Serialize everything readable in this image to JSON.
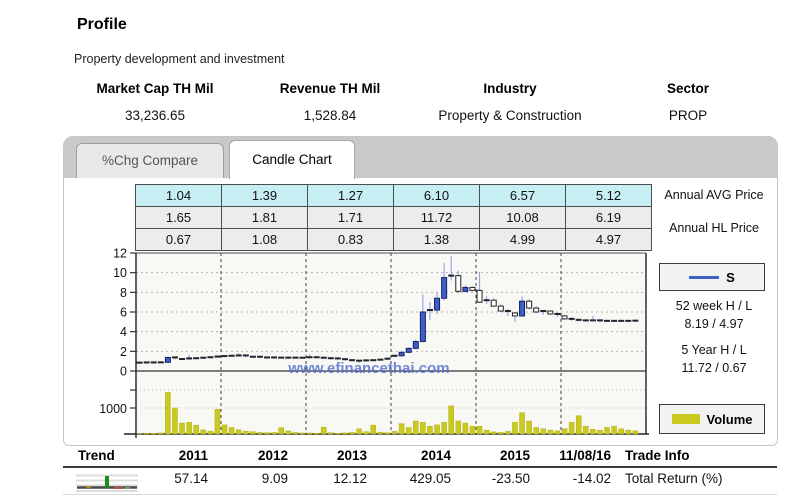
{
  "page": {
    "title": "Profile",
    "subtitle": "Property development and investment"
  },
  "stats": {
    "columns": [
      {
        "label": "Market Cap TH Mil",
        "value": "33,236.65"
      },
      {
        "label": "Revenue TH Mil",
        "value": "1,528.84"
      },
      {
        "label": "Industry",
        "value": "Property & Construction"
      },
      {
        "label": "Sector",
        "value": "PROP"
      }
    ]
  },
  "tabs": [
    {
      "label": "%Chg Compare",
      "active": false
    },
    {
      "label": "Candle Chart",
      "active": true
    }
  ],
  "annual_table": {
    "years": [
      "2011",
      "2012",
      "2013",
      "2014",
      "2015",
      "2016"
    ],
    "avg_row": [
      "1.04",
      "1.39",
      "1.27",
      "6.10",
      "6.57",
      "5.12"
    ],
    "high_row": [
      "1.65",
      "1.81",
      "1.71",
      "11.72",
      "10.08",
      "6.19"
    ],
    "low_row": [
      "0.67",
      "1.08",
      "0.83",
      "1.38",
      "4.99",
      "4.97"
    ]
  },
  "side_panel": {
    "avg_label": "Annual AVG Price",
    "hl_label": "Annual HL Price",
    "series_legend": "S",
    "week52_label": "52 week H / L",
    "week52_value": "8.19 / 4.97",
    "year5_label": "5 Year H / L",
    "year5_value": "11.72 / 0.67",
    "volume_legend": "Volume"
  },
  "watermark": "www.efinancethai.com",
  "chart_data": {
    "type": "candlestick+volume",
    "title": "Candle Chart (monthly, 2011 - 11/08/16)",
    "years": [
      "2011",
      "2012",
      "2013",
      "2014",
      "2015",
      "2016"
    ],
    "price_axis_ticks": [
      0,
      2,
      4,
      6,
      8,
      10,
      12
    ],
    "price_ylim": [
      0,
      12
    ],
    "volume_axis_tick": 1000,
    "grid": true,
    "ohlc_order": "open,high,low,close (monthly from Jan 2011 to Nov 2016)",
    "ohlc": [
      [
        0.85,
        0.9,
        0.8,
        0.85
      ],
      [
        0.85,
        0.92,
        0.78,
        0.87
      ],
      [
        0.87,
        0.9,
        0.82,
        0.85
      ],
      [
        0.85,
        0.92,
        0.8,
        0.88
      ],
      [
        0.88,
        1.45,
        0.85,
        1.38
      ],
      [
        1.38,
        1.45,
        1.18,
        1.22
      ],
      [
        1.22,
        1.3,
        1.12,
        1.18
      ],
      [
        1.18,
        1.65,
        1.1,
        1.28
      ],
      [
        1.28,
        1.35,
        1.2,
        1.3
      ],
      [
        1.3,
        1.38,
        1.25,
        1.35
      ],
      [
        1.35,
        1.42,
        1.28,
        1.4
      ],
      [
        1.4,
        1.5,
        1.35,
        1.47
      ],
      [
        1.47,
        1.55,
        1.42,
        1.52
      ],
      [
        1.52,
        1.6,
        1.45,
        1.55
      ],
      [
        1.55,
        1.81,
        1.48,
        1.58
      ],
      [
        1.58,
        1.62,
        1.38,
        1.42
      ],
      [
        1.42,
        1.5,
        1.35,
        1.45
      ],
      [
        1.45,
        1.48,
        1.3,
        1.35
      ],
      [
        1.35,
        1.42,
        1.28,
        1.38
      ],
      [
        1.38,
        1.42,
        1.3,
        1.36
      ],
      [
        1.36,
        1.4,
        1.28,
        1.34
      ],
      [
        1.34,
        1.4,
        1.25,
        1.36
      ],
      [
        1.36,
        1.4,
        1.3,
        1.35
      ],
      [
        1.35,
        1.4,
        1.28,
        1.33
      ],
      [
        1.33,
        1.71,
        1.25,
        1.4
      ],
      [
        1.4,
        1.45,
        1.3,
        1.35
      ],
      [
        1.35,
        1.38,
        1.25,
        1.3
      ],
      [
        1.3,
        1.35,
        1.2,
        1.28
      ],
      [
        1.28,
        1.32,
        1.15,
        1.2
      ],
      [
        1.2,
        1.25,
        1.05,
        1.1
      ],
      [
        1.1,
        1.18,
        0.95,
        1.05
      ],
      [
        1.05,
        1.1,
        0.83,
        1.0
      ],
      [
        1.0,
        1.12,
        0.95,
        1.08
      ],
      [
        1.08,
        1.15,
        1.0,
        1.1
      ],
      [
        1.1,
        1.2,
        1.05,
        1.15
      ],
      [
        1.15,
        1.3,
        1.1,
        1.25
      ],
      [
        1.38,
        1.6,
        1.38,
        1.55
      ],
      [
        1.55,
        2.0,
        1.45,
        1.9
      ],
      [
        1.9,
        2.4,
        1.8,
        2.3
      ],
      [
        2.3,
        3.2,
        2.2,
        3.0
      ],
      [
        3.0,
        7.8,
        2.9,
        6.0
      ],
      [
        6.0,
        7.0,
        5.2,
        6.2
      ],
      [
        6.2,
        8.0,
        5.8,
        7.4
      ],
      [
        7.4,
        11.0,
        7.2,
        9.5
      ],
      [
        9.5,
        11.72,
        9.2,
        9.7
      ],
      [
        9.7,
        10.2,
        7.9,
        8.1
      ],
      [
        8.1,
        8.7,
        8.0,
        8.5
      ],
      [
        8.5,
        8.6,
        8.1,
        8.2
      ],
      [
        8.2,
        10.08,
        6.9,
        7.0
      ],
      [
        7.0,
        7.6,
        6.8,
        7.2
      ],
      [
        7.2,
        7.4,
        6.5,
        6.6
      ],
      [
        6.6,
        6.8,
        6.0,
        6.1
      ],
      [
        6.1,
        6.3,
        5.6,
        5.9
      ],
      [
        5.9,
        6.0,
        4.99,
        5.6
      ],
      [
        5.6,
        7.6,
        5.5,
        7.1
      ],
      [
        7.1,
        7.3,
        6.3,
        6.4
      ],
      [
        6.4,
        6.6,
        5.9,
        6.0
      ],
      [
        6.0,
        6.2,
        5.7,
        6.1
      ],
      [
        6.1,
        6.15,
        5.7,
        5.8
      ],
      [
        5.8,
        5.95,
        5.5,
        5.6
      ],
      [
        5.6,
        5.7,
        5.2,
        5.3
      ],
      [
        5.3,
        5.45,
        5.1,
        5.2
      ],
      [
        5.2,
        5.3,
        5.05,
        5.15
      ],
      [
        5.15,
        5.25,
        5.0,
        5.1
      ],
      [
        5.1,
        5.6,
        5.05,
        5.15
      ],
      [
        5.15,
        5.25,
        4.97,
        5.1
      ],
      [
        5.1,
        5.15,
        5.0,
        5.05
      ],
      [
        5.05,
        5.15,
        5.0,
        5.1
      ],
      [
        5.1,
        5.2,
        5.0,
        5.05
      ],
      [
        5.05,
        5.15,
        4.98,
        5.1
      ],
      [
        5.1,
        5.15,
        5.05,
        5.12
      ]
    ],
    "volumes": [
      15,
      20,
      25,
      40,
      1600,
      1000,
      420,
      450,
      340,
      160,
      110,
      950,
      350,
      250,
      160,
      110,
      90,
      60,
      50,
      60,
      240,
      120,
      60,
      40,
      40,
      30,
      260,
      50,
      30,
      40,
      60,
      200,
      90,
      340,
      70,
      50,
      100,
      400,
      250,
      500,
      450,
      300,
      350,
      450,
      1080,
      500,
      420,
      300,
      300,
      150,
      80,
      60,
      100,
      450,
      820,
      500,
      250,
      200,
      150,
      120,
      200,
      450,
      700,
      300,
      180,
      150,
      250,
      300,
      200,
      150,
      120
    ]
  },
  "bottom_table": {
    "trend_header": "Trend",
    "trade_info_header": "Trade Info",
    "row_label": "Total Return (%)",
    "columns": [
      {
        "label": "2011",
        "value": "57.14"
      },
      {
        "label": "2012",
        "value": "9.09"
      },
      {
        "label": "2013",
        "value": "12.12"
      },
      {
        "label": "2014",
        "value": "429.05"
      },
      {
        "label": "2015",
        "value": "-23.50"
      },
      {
        "label": "11/08/16",
        "value": "-14.02"
      }
    ]
  },
  "colors": {
    "candle_up": "#3d5fc6",
    "candle_up_border": "#15226b",
    "candle_down": "#ffffff",
    "candle_down_border": "#222222",
    "wick": "#8fa0e8",
    "volume": "#c9c91f",
    "table_highlight": "#c7eef3",
    "watermark": "#4f6dd0",
    "tabstrip": "#c9c9c9"
  }
}
